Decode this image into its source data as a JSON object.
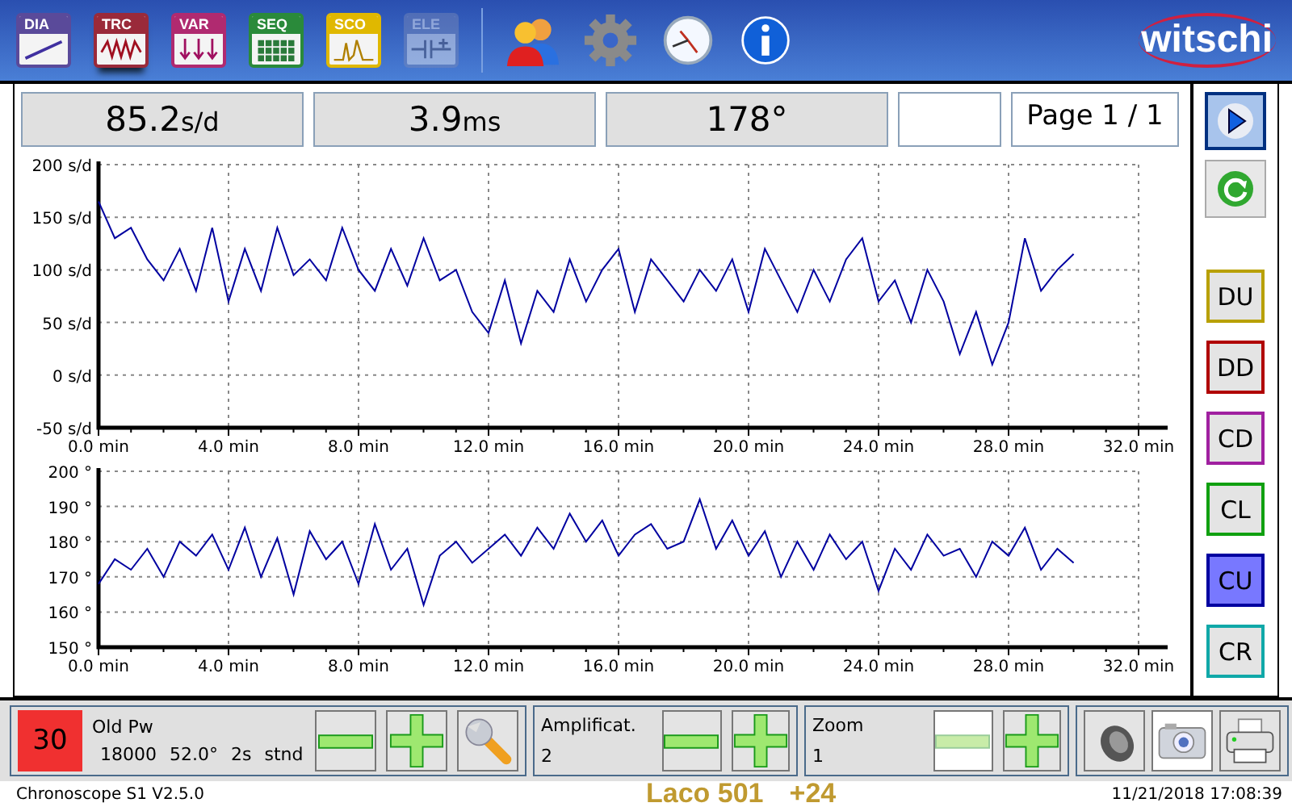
{
  "toolbar": {
    "items": [
      {
        "label": "DIA",
        "kind": "diagram",
        "selected": false,
        "disabled": false
      },
      {
        "label": "TRC",
        "kind": "trace",
        "selected": true,
        "disabled": false
      },
      {
        "label": "VAR",
        "kind": "variation",
        "selected": false,
        "disabled": false
      },
      {
        "label": "SEQ",
        "kind": "sequence",
        "selected": false,
        "disabled": false
      },
      {
        "label": "SCO",
        "kind": "scope",
        "selected": false,
        "disabled": false
      },
      {
        "label": "ELE",
        "kind": "electronic",
        "selected": false,
        "disabled": true
      }
    ],
    "tools": [
      {
        "kind": "users"
      },
      {
        "kind": "settings"
      },
      {
        "kind": "clock"
      },
      {
        "kind": "info"
      }
    ],
    "logo": "witschi"
  },
  "readouts": [
    {
      "kind": "value",
      "value": "85.2",
      "unit": "s/d"
    },
    {
      "kind": "value",
      "value": "3.9",
      "unit": "ms"
    },
    {
      "kind": "value",
      "value": "178°"
    },
    {
      "kind": "blank"
    },
    {
      "kind": "page",
      "value": "Page 1 / 1"
    }
  ],
  "charts": [
    {
      "chart_data": {
        "type": "line",
        "grid": true,
        "ylim": [
          -50,
          200
        ],
        "xlim": [
          0,
          32
        ],
        "yticks": [
          {
            "value": 200,
            "label": "200 s/d"
          },
          {
            "value": 150,
            "label": "150 s/d"
          },
          {
            "value": 100,
            "label": "100 s/d"
          },
          {
            "value": 50,
            "label": "50 s/d"
          },
          {
            "value": 0,
            "label": "0 s/d"
          },
          {
            "value": -50,
            "label": "-50 s/d"
          }
        ],
        "xticks": [
          {
            "value": 0,
            "label": "0.0 min"
          },
          {
            "value": 4,
            "label": "4.0 min"
          },
          {
            "value": 8,
            "label": "8.0 min"
          },
          {
            "value": 12,
            "label": "12.0 min"
          },
          {
            "value": 16,
            "label": "16.0 min"
          },
          {
            "value": 20,
            "label": "20.0 min"
          },
          {
            "value": 24,
            "label": "24.0 min"
          },
          {
            "value": 28,
            "label": "28.0 min"
          },
          {
            "value": 32,
            "label": "32.0 min"
          }
        ],
        "x": [
          0,
          0.5,
          1,
          1.5,
          2,
          2.5,
          3,
          3.5,
          4,
          4.5,
          5,
          5.5,
          6,
          6.5,
          7,
          7.5,
          8,
          8.5,
          9,
          9.5,
          10,
          10.5,
          11,
          11.5,
          12,
          12.5,
          13,
          13.5,
          14,
          14.5,
          15,
          15.5,
          16,
          16.5,
          17,
          17.5,
          18,
          18.5,
          19,
          19.5,
          20,
          20.5,
          21,
          21.5,
          22,
          22.5,
          23,
          23.5,
          24,
          24.5,
          25,
          25.5,
          26,
          26.5,
          27,
          27.5,
          28,
          28.5,
          29,
          29.5,
          30
        ],
        "series": [
          {
            "color": "#0000a0",
            "values": [
              165,
              130,
              140,
              110,
              90,
              120,
              80,
              140,
              70,
              120,
              80,
              140,
              95,
              110,
              90,
              140,
              100,
              80,
              120,
              85,
              130,
              90,
              100,
              60,
              40,
              90,
              30,
              80,
              60,
              110,
              70,
              100,
              120,
              60,
              110,
              90,
              70,
              100,
              80,
              110,
              60,
              120,
              90,
              60,
              100,
              70,
              110,
              130,
              70,
              90,
              50,
              100,
              70,
              20,
              60,
              10,
              50,
              130,
              80,
              100,
              115
            ]
          }
        ]
      }
    },
    {
      "chart_data": {
        "type": "line",
        "grid": true,
        "ylim": [
          150,
          200
        ],
        "xlim": [
          0,
          32
        ],
        "yticks": [
          {
            "value": 200,
            "label": "200 °"
          },
          {
            "value": 190,
            "label": "190 °"
          },
          {
            "value": 180,
            "label": "180 °"
          },
          {
            "value": 170,
            "label": "170 °"
          },
          {
            "value": 160,
            "label": "160 °"
          },
          {
            "value": 150,
            "label": "150 °"
          }
        ],
        "xticks": [
          {
            "value": 0,
            "label": "0.0 min"
          },
          {
            "value": 4,
            "label": "4.0 min"
          },
          {
            "value": 8,
            "label": "8.0 min"
          },
          {
            "value": 12,
            "label": "12.0 min"
          },
          {
            "value": 16,
            "label": "16.0 min"
          },
          {
            "value": 20,
            "label": "20.0 min"
          },
          {
            "value": 24,
            "label": "24.0 min"
          },
          {
            "value": 28,
            "label": "28.0 min"
          },
          {
            "value": 32,
            "label": "32.0 min"
          }
        ],
        "x": [
          0,
          0.5,
          1,
          1.5,
          2,
          2.5,
          3,
          3.5,
          4,
          4.5,
          5,
          5.5,
          6,
          6.5,
          7,
          7.5,
          8,
          8.5,
          9,
          9.5,
          10,
          10.5,
          11,
          11.5,
          12,
          12.5,
          13,
          13.5,
          14,
          14.5,
          15,
          15.5,
          16,
          16.5,
          17,
          17.5,
          18,
          18.5,
          19,
          19.5,
          20,
          20.5,
          21,
          21.5,
          22,
          22.5,
          23,
          23.5,
          24,
          24.5,
          25,
          25.5,
          26,
          26.5,
          27,
          27.5,
          28,
          28.5,
          29,
          29.5,
          30
        ],
        "series": [
          {
            "color": "#0000a0",
            "values": [
              168,
              175,
              172,
              178,
              170,
              180,
              176,
              182,
              172,
              184,
              170,
              181,
              165,
              183,
              175,
              180,
              168,
              185,
              172,
              178,
              162,
              176,
              180,
              174,
              178,
              182,
              176,
              184,
              178,
              188,
              180,
              186,
              176,
              182,
              185,
              178,
              180,
              192,
              178,
              186,
              176,
              183,
              170,
              180,
              172,
              182,
              175,
              180,
              166,
              178,
              172,
              182,
              176,
              178,
              170,
              180,
              176,
              184,
              172,
              178,
              174
            ]
          }
        ]
      }
    }
  ],
  "side": {
    "actions": [
      {
        "kind": "next"
      },
      {
        "kind": "refresh"
      }
    ],
    "modes": [
      {
        "label": "DU",
        "color": "#b8a000",
        "selected": false
      },
      {
        "label": "DD",
        "color": "#b00000",
        "selected": false
      },
      {
        "label": "CD",
        "color": "#a020a0",
        "selected": false
      },
      {
        "label": "CL",
        "color": "#10a010",
        "selected": false
      },
      {
        "label": "CU",
        "color": "#0000a0",
        "selected": true
      },
      {
        "label": "CR",
        "color": "#10a8a8",
        "selected": false
      }
    ]
  },
  "bottom": {
    "lift": {
      "value": "30",
      "name": "Old Pw",
      "details": [
        "18000",
        "52.0°",
        "2s",
        "stnd"
      ],
      "minus_disabled": false,
      "plus_disabled": false
    },
    "amplification": {
      "name": "Amplificat.",
      "value": "2",
      "minus_disabled": false,
      "plus_disabled": false
    },
    "zoom": {
      "name": "Zoom",
      "value": "1",
      "minus_disabled": true,
      "plus_disabled": false
    },
    "tools": [
      {
        "kind": "speaker"
      },
      {
        "kind": "camera"
      },
      {
        "kind": "printer"
      }
    ]
  },
  "status_bar": {
    "version": "Chronoscope S1 V2.5.0",
    "watch": "Laco 501",
    "offset": "+24",
    "datetime": "11/21/2018 17:08:39"
  }
}
